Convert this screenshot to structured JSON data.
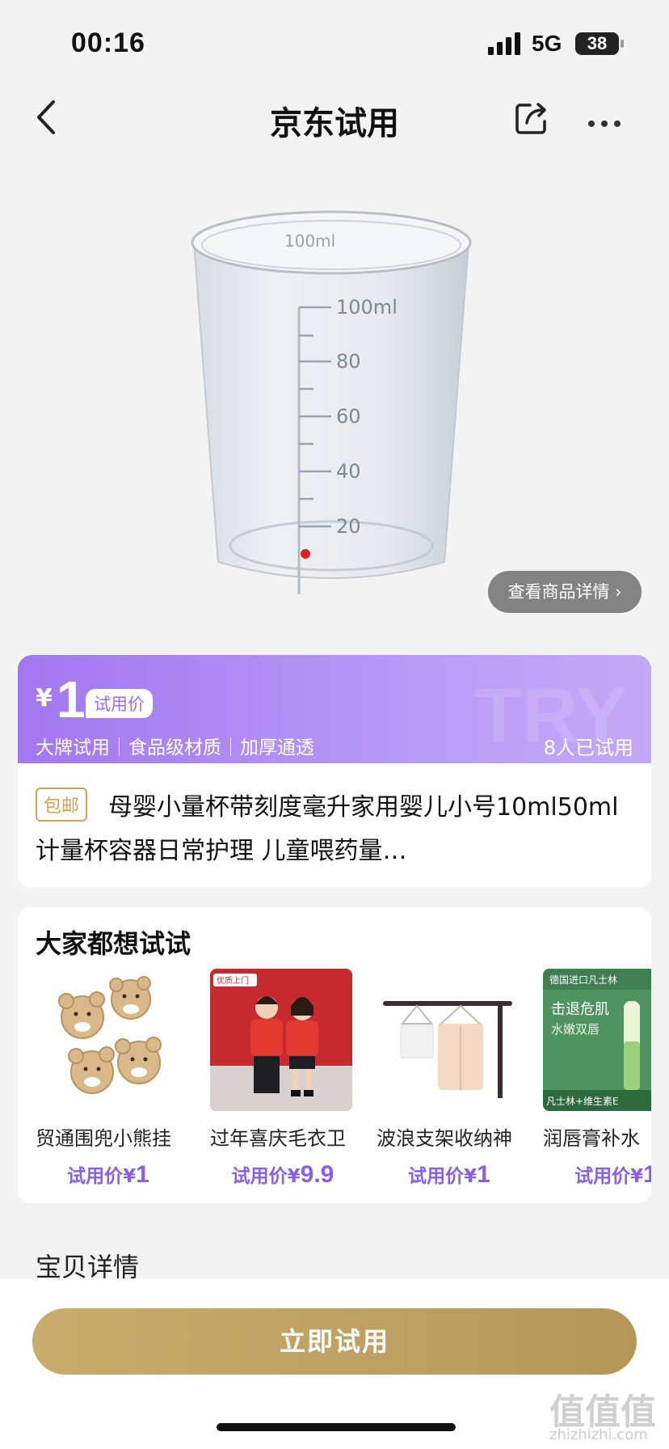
{
  "status": {
    "time": "00:16",
    "network": "5G",
    "battery": "38"
  },
  "nav": {
    "title": "京东试用"
  },
  "product": {
    "detail_button": "查看商品详情",
    "price_symbol": "¥",
    "price": "1",
    "price_tag": "试用价",
    "features": "大牌试用｜食品级材质｜加厚通透",
    "tried_count": "8人已试用",
    "watermark": "TRY",
    "shipping_badge": "包邮",
    "title": "母婴小量杯带刻度毫升家用婴儿小号10ml50ml计量杯容器日常护理 儿童喂药量…",
    "cup_labels": [
      "100ml",
      "100ml",
      "80",
      "60",
      "40",
      "20"
    ]
  },
  "recommend": {
    "title": "大家都想试试",
    "items": [
      {
        "name": "贸通围兜小熊挂",
        "price_label": "试用价¥",
        "price": "1"
      },
      {
        "name": "过年喜庆毛衣卫",
        "price_label": "试用价¥",
        "price": "9.9"
      },
      {
        "name": "波浪支架收纳神",
        "price_label": "试用价¥",
        "price": "1"
      },
      {
        "name": "润唇膏补水",
        "price_label": "试用价¥",
        "price": "1"
      }
    ],
    "lip_banner": "德国进口凡士林",
    "lip_line1": "击退危肌",
    "lip_line2": "水嫩双唇",
    "lip_footer": "凡士林+维生素E",
    "sweater_banner": "优质上门"
  },
  "section": {
    "title": "宝贝详情"
  },
  "cta": {
    "label": "立即试用"
  },
  "watermark": {
    "text": "值值值",
    "url": "zhizhizhi.com"
  },
  "colors": {
    "accent": "#a277f0",
    "gold": "#c9ad6d",
    "price_text": "#8a5fe6"
  }
}
